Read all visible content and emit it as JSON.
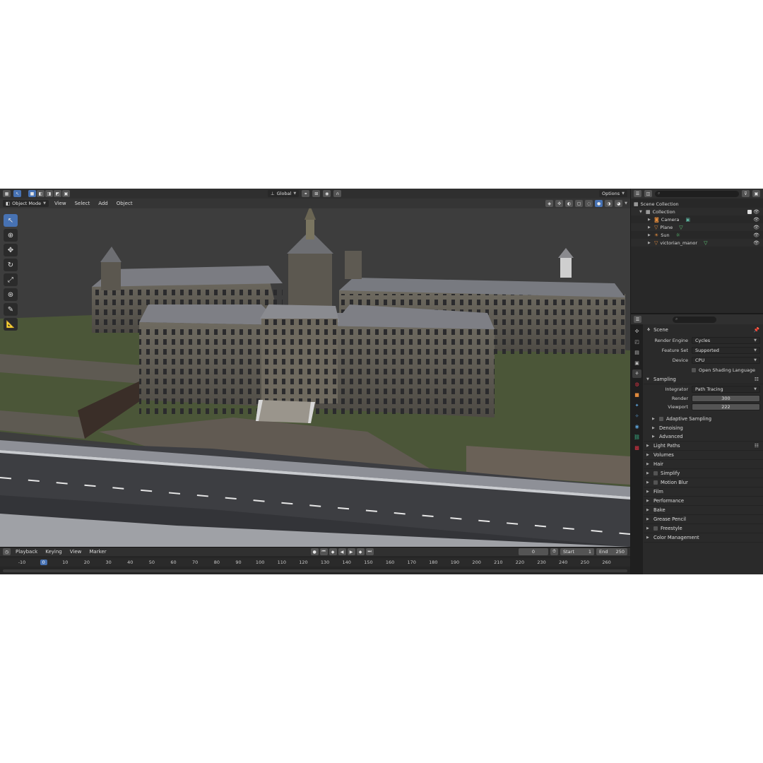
{
  "viewport": {
    "header_icons": [
      "editor-type-icon",
      "select-box-icon"
    ],
    "transform_orientation": "Global",
    "options_label": "Options",
    "mode": "Object Mode",
    "menu": [
      "View",
      "Select",
      "Add",
      "Object"
    ]
  },
  "timeline": {
    "menu": [
      "Playback",
      "Keying",
      "View",
      "Marker"
    ],
    "current_frame": "0",
    "start_label": "Start",
    "start_value": "1",
    "end_label": "End",
    "end_value": "250",
    "ruler": [
      "-10",
      "0",
      "10",
      "20",
      "30",
      "40",
      "50",
      "60",
      "70",
      "80",
      "90",
      "100",
      "110",
      "120",
      "130",
      "140",
      "150",
      "160",
      "170",
      "180",
      "190",
      "200",
      "210",
      "220",
      "230",
      "240",
      "250",
      "260"
    ]
  },
  "outliner": {
    "scene_collection": "Scene Collection",
    "collection": "Collection",
    "items": [
      {
        "name": "Camera"
      },
      {
        "name": "Plane"
      },
      {
        "name": "Sun"
      },
      {
        "name": "victorian_manor"
      }
    ]
  },
  "properties": {
    "context": "Scene",
    "render_engine_label": "Render Engine",
    "render_engine": "Cycles",
    "feature_set_label": "Feature Set",
    "feature_set": "Supported",
    "device_label": "Device",
    "device": "CPU",
    "osl_label": "Open Shading Language",
    "sampling": "Sampling",
    "integrator_label": "Integrator",
    "integrator": "Path Tracing",
    "render_label": "Render",
    "render_samples": "300",
    "viewport_label": "Viewport",
    "viewport_samples": "222",
    "adaptive": "Adaptive Sampling",
    "denoising": "Denoising",
    "advanced": "Advanced",
    "panels": [
      "Light Paths",
      "Volumes",
      "Hair",
      "Simplify",
      "Motion Blur",
      "Film",
      "Performance",
      "Bake",
      "Grease Pencil",
      "Freestyle",
      "Color Management"
    ]
  },
  "colors": {
    "accent": "#4772b3",
    "bg": "#1d1d1d",
    "panel": "#2a2a2a",
    "grass": "#4e5a3a",
    "road": "#3d3e42"
  }
}
